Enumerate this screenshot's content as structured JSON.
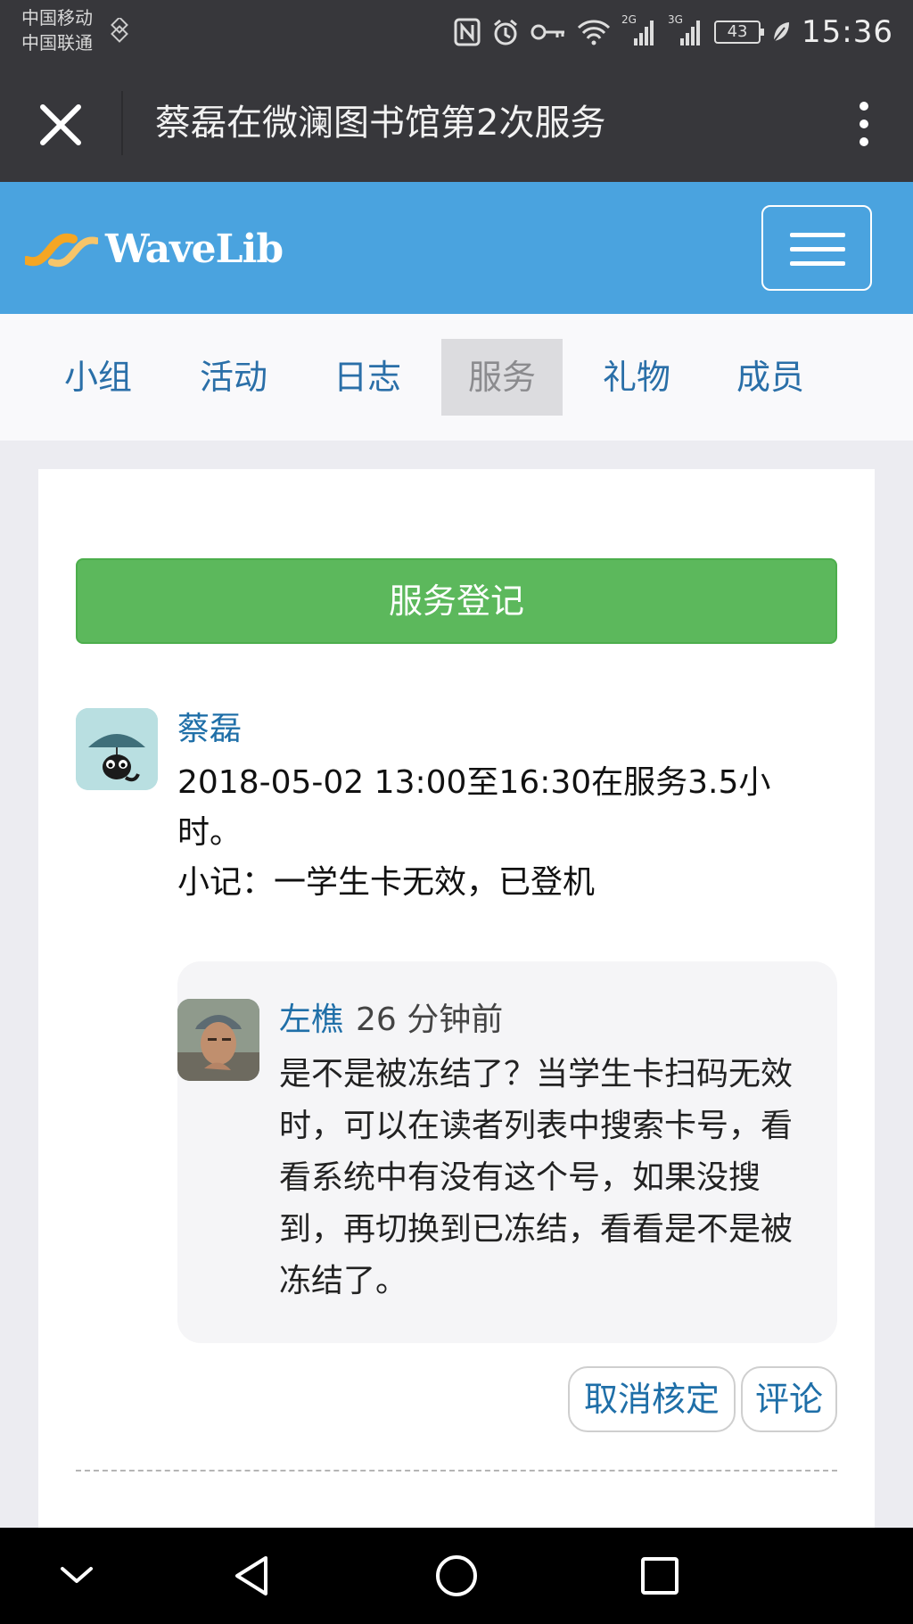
{
  "status": {
    "carrier_1": "中国移动",
    "carrier_2": "中国联通",
    "network_2g": "2G",
    "network_3g": "3G",
    "battery": "43",
    "time": "15:36"
  },
  "title_bar": {
    "title": "蔡磊在微澜图书馆第2次服务"
  },
  "brand": {
    "logo_text": "WaveLib",
    "color": "#4aa3df"
  },
  "tabs": [
    {
      "label": "小组"
    },
    {
      "label": "活动"
    },
    {
      "label": "日志"
    },
    {
      "label": "服务"
    },
    {
      "label": "礼物"
    },
    {
      "label": "成员"
    }
  ],
  "register_button": "服务登记",
  "post": {
    "author": "蔡磊",
    "line1": "2018-05-02 13:00至16:30在服务3.5小时。",
    "line2": "小记：一学生卡无效，已登机"
  },
  "comment": {
    "author": "左樵",
    "time": "26 分钟前",
    "text": "是不是被冻结了？当学生卡扫码无效时，可以在读者列表中搜索卡号，看看系统中有没有这个号，如果没搜到，再切换到已冻结，看看是不是被冻结了。"
  },
  "actions": {
    "cancel_verify": "取消核定",
    "comment": "评论"
  },
  "colors": {
    "accent_green": "#5cb85c",
    "link_blue": "#1f6fa8",
    "dark_bar": "#37373b"
  }
}
